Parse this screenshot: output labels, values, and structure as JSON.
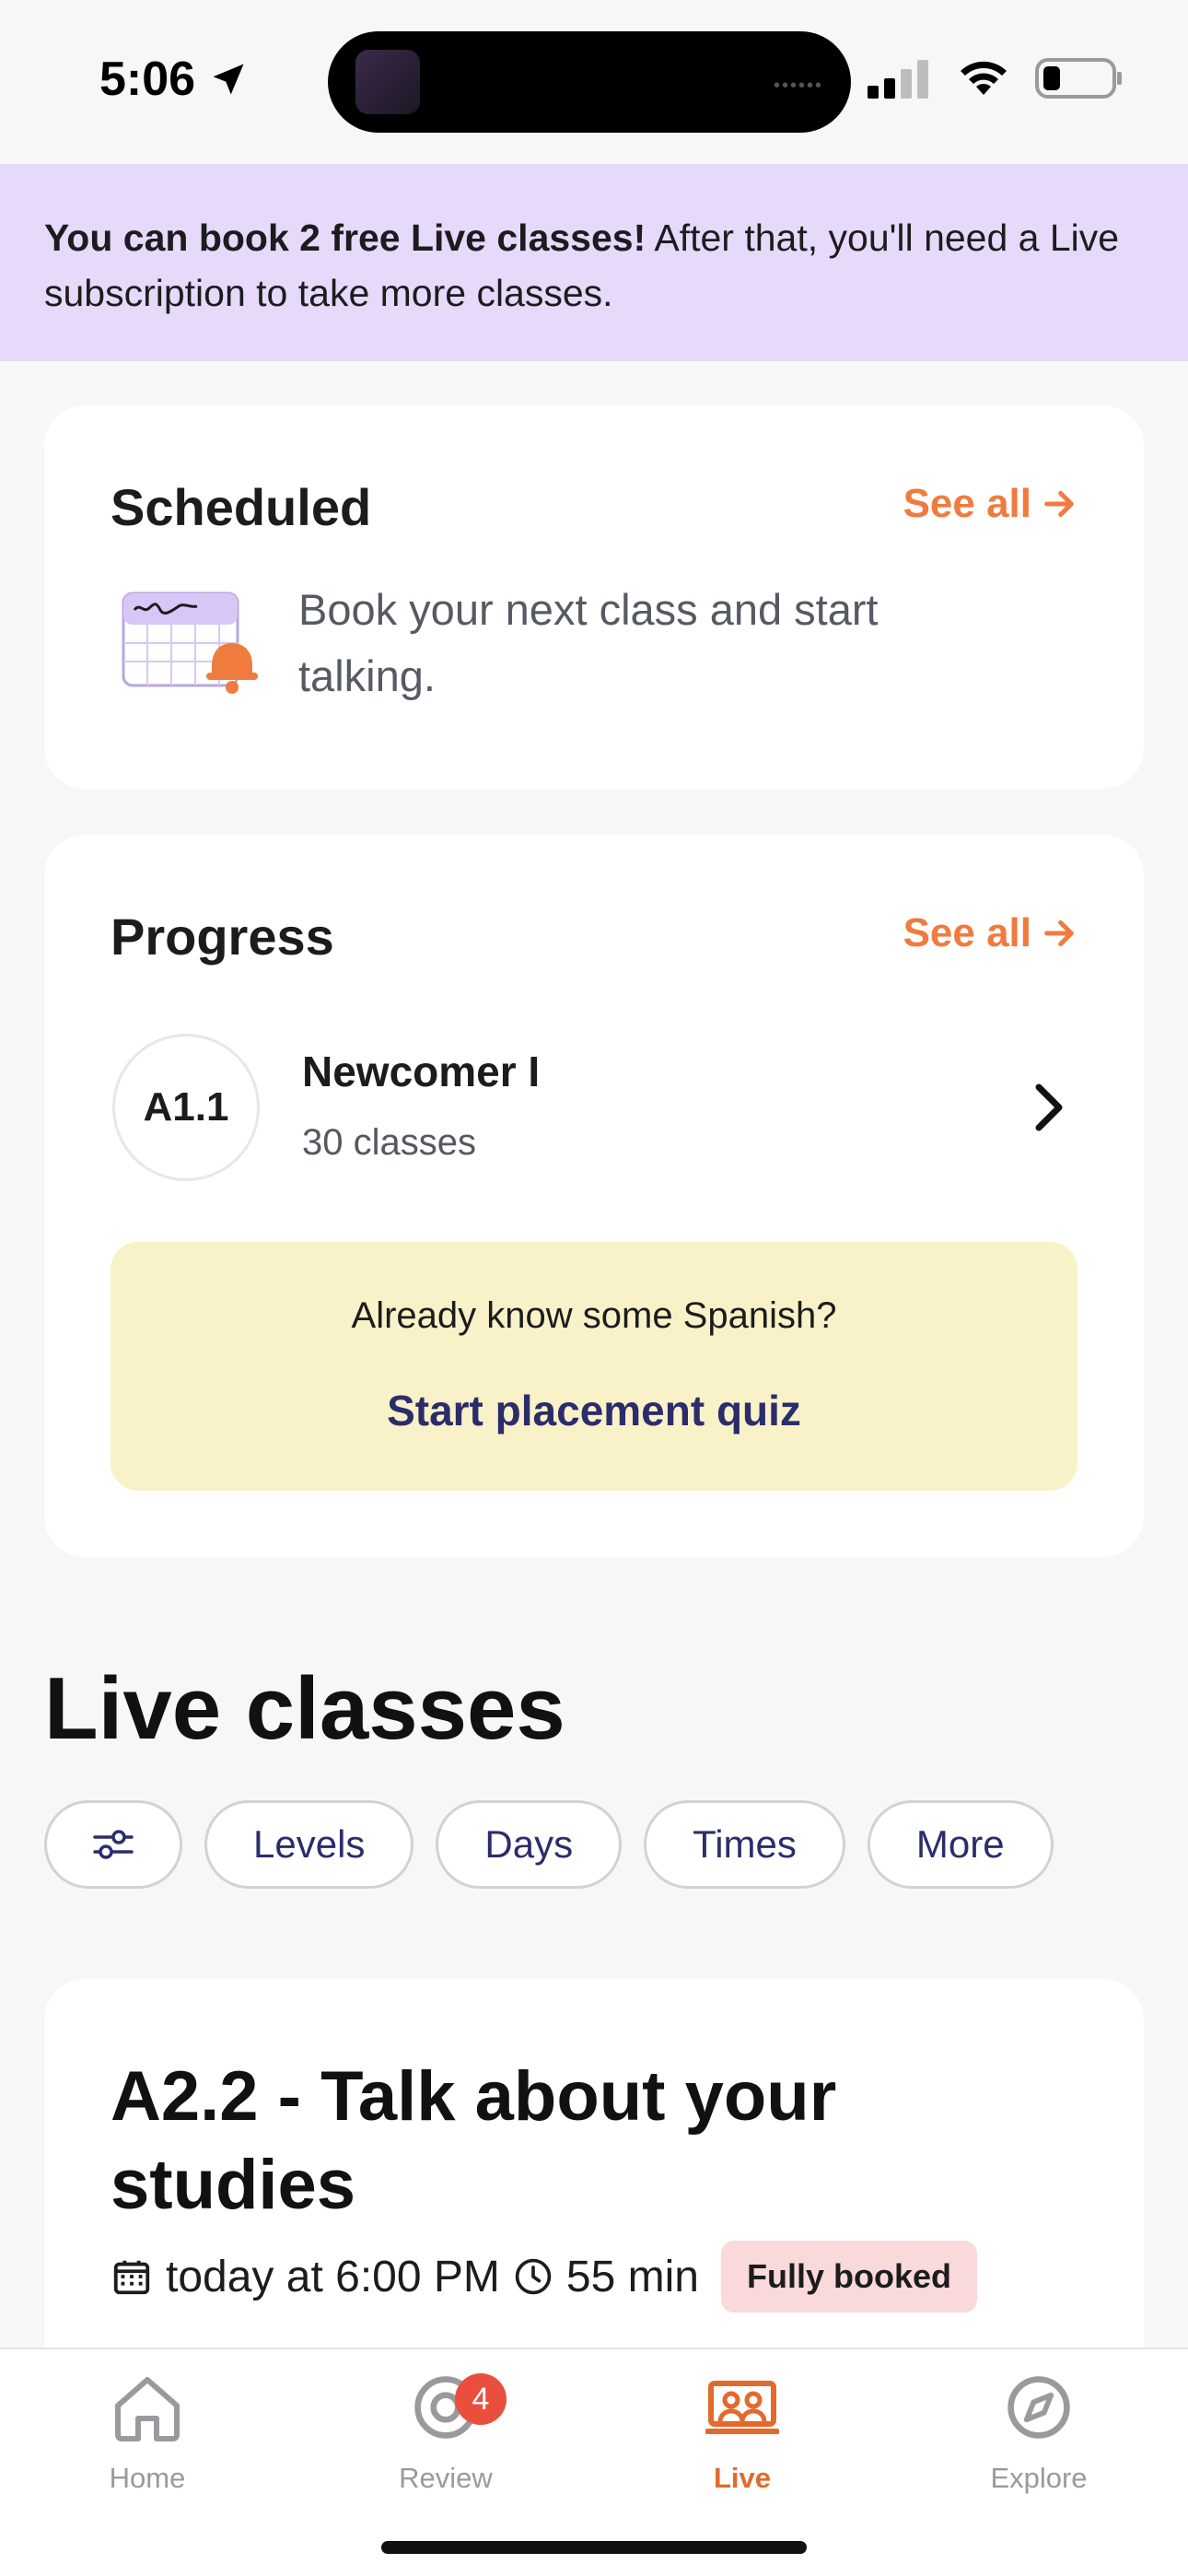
{
  "status_bar": {
    "time": "5:06"
  },
  "banner": {
    "bold_text": "You can book 2 free Live classes!",
    "text": " After that, you'll need a Live subscription to take more classes."
  },
  "scheduled": {
    "title": "Scheduled",
    "see_all": "See all",
    "message": "Book your next class and start talking."
  },
  "progress": {
    "title": "Progress",
    "see_all": "See all",
    "level_code": "A1.1",
    "level_name": "Newcomer I",
    "level_classes": "30 classes",
    "quiz_question": "Already know some Spanish?",
    "quiz_link": "Start placement quiz"
  },
  "live_classes": {
    "title": "Live classes",
    "filters": [
      "Levels",
      "Days",
      "Times",
      "More"
    ],
    "class_card": {
      "title": "A2.2 - Talk about your studies",
      "date": "today at 6:00 PM",
      "duration": "55 min",
      "status": "Fully booked"
    }
  },
  "tab_bar": {
    "tabs": [
      {
        "label": "Home",
        "icon": "home-icon"
      },
      {
        "label": "Review",
        "icon": "target-icon",
        "badge": "4"
      },
      {
        "label": "Live",
        "icon": "live-class-icon",
        "active": true
      },
      {
        "label": "Explore",
        "icon": "compass-icon"
      }
    ]
  },
  "colors": {
    "accent": "#f07b3f",
    "banner_bg": "#e6d9fa",
    "quiz_bg": "#f9f2c8",
    "link": "#2b2d6b",
    "badge_bg": "#ea4f3d",
    "booked_bg": "#f9d9d9"
  }
}
